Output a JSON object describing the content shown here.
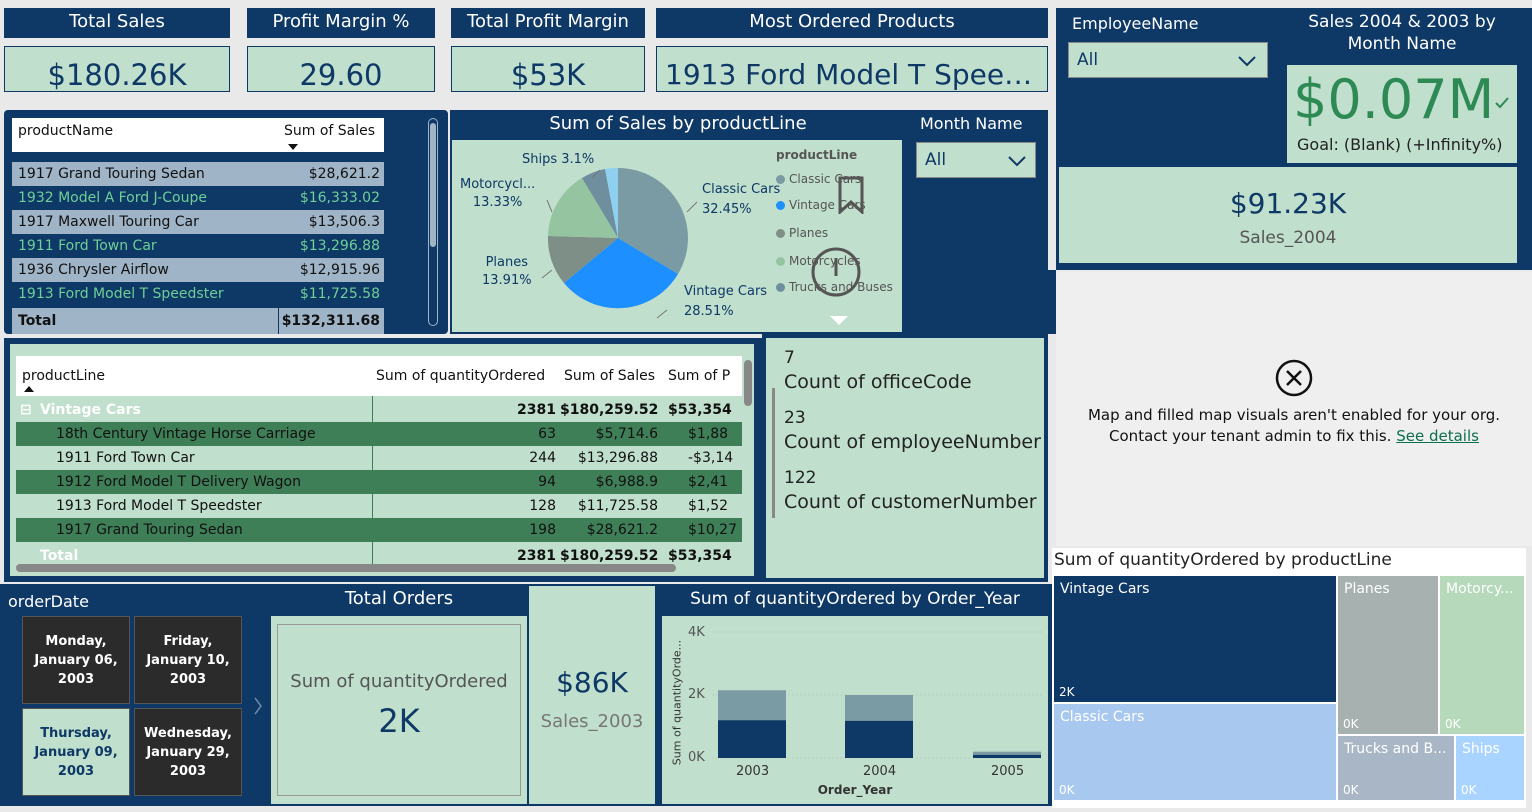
{
  "kpis": {
    "total_sales": {
      "title": "Total Sales",
      "value": "$180.26K"
    },
    "profit_margin_pct": {
      "title": "Profit Margin %",
      "value": "29.60"
    },
    "total_profit_margin": {
      "title": "Total Profit Margin",
      "value": "$53K"
    },
    "most_ordered": {
      "title": "Most Ordered Products",
      "value": "1913 Ford Model T Speed..."
    }
  },
  "employee_slicer": {
    "label": "EmployeeName",
    "value": "All"
  },
  "gauge_card": {
    "title": "Sales 2004 & 2003 by Month Name",
    "value": "$0.07M",
    "goal": "Goal: (Blank) (+Infinity%)"
  },
  "sales_2004_card": {
    "value": "$91.23K",
    "label": "Sales_2004"
  },
  "map_error": {
    "line1": "Map and filled map visuals aren't enabled for your org.",
    "line2": "Contact your tenant admin to fix this.",
    "link": "See details"
  },
  "product_table": {
    "headers": [
      "productName",
      "Sum of Sales"
    ],
    "rows": [
      [
        "1917 Grand Touring Sedan",
        "$28,621.2"
      ],
      [
        "1932 Model A Ford J-Coupe",
        "$16,333.02"
      ],
      [
        "1917 Maxwell Touring Car",
        "$13,506.3"
      ],
      [
        "1911 Ford Town Car",
        "$13,296.88"
      ],
      [
        "1936 Chrysler Airflow",
        "$12,915.96"
      ],
      [
        "1913 Ford Model T Speedster",
        "$11,725.58"
      ]
    ],
    "total_label": "Total",
    "total_value": "$132,311.68"
  },
  "pie": {
    "title": "Sum of Sales by productLine",
    "legend_title": "productLine",
    "legend": [
      {
        "name": "Classic Cars",
        "color": "#7a9aa4"
      },
      {
        "name": "Vintage Cars",
        "color": "#1e8fff"
      },
      {
        "name": "Planes",
        "color": "#7d8f87"
      },
      {
        "name": "Motorcycles",
        "color": "#95c5a0"
      },
      {
        "name": "Trucks and Buses",
        "color": "#6f8f9f"
      }
    ],
    "labels": [
      {
        "name": "Ships 3.1%",
        "pct": ""
      },
      {
        "name": "Motorcycl...",
        "pct": "13.33%"
      },
      {
        "name": "Classic Cars",
        "pct": "32.45%"
      },
      {
        "name": "Planes",
        "pct": "13.91%"
      },
      {
        "name": "Vintage Cars",
        "pct": "28.51%"
      }
    ]
  },
  "chart_data": [
    {
      "type": "pie",
      "title": "Sum of Sales by productLine",
      "categories": [
        "Classic Cars",
        "Vintage Cars",
        "Planes",
        "Motorcycles",
        "Trucks and Buses",
        "Ships"
      ],
      "values": [
        32.45,
        28.51,
        13.91,
        13.33,
        8.7,
        3.1
      ]
    },
    {
      "type": "bar",
      "title": "Sum of quantityOrdered by Order_Year",
      "xlabel": "Order_Year",
      "ylabel": "Sum of quantityOrde...",
      "categories": [
        "2003",
        "2004",
        "2005"
      ],
      "series": [
        {
          "values": [
            1200,
            1180,
            100
          ],
          "color": "#0e3866"
        },
        {
          "values": [
            2150,
            2000,
            200
          ],
          "color": "#7a9aa4"
        }
      ],
      "ylim": [
        0,
        4000
      ],
      "yticks": [
        "0K",
        "2K",
        "4K"
      ]
    },
    {
      "type": "treemap",
      "title": "Sum of quantityOrdered by productLine",
      "categories": [
        "Vintage Cars",
        "Classic Cars",
        "Planes",
        "Motorcy...",
        "Trucks and B...",
        "Ships"
      ],
      "labels": [
        "2K",
        "0K",
        "0K",
        "0K",
        "0K",
        "0K"
      ]
    }
  ],
  "month_slicer": {
    "label": "Month Name",
    "value": "All"
  },
  "matrix": {
    "headers": [
      "productLine",
      "Sum of quantityOrdered",
      "Sum of Sales",
      "Sum of P"
    ],
    "group": {
      "label": "Vintage Cars",
      "qty": "2381",
      "sales": "$180,259.52",
      "profit": "$53,354"
    },
    "rows": [
      {
        "name": "18th Century Vintage Horse Carriage",
        "qty": "63",
        "sales": "$5,714.6",
        "profit": "$1,88"
      },
      {
        "name": "1911 Ford Town Car",
        "qty": "244",
        "sales": "$13,296.88",
        "profit": "-$3,14"
      },
      {
        "name": "1912 Ford Model T Delivery Wagon",
        "qty": "94",
        "sales": "$6,988.9",
        "profit": "$2,41"
      },
      {
        "name": "1913 Ford Model T Speedster",
        "qty": "128",
        "sales": "$11,725.58",
        "profit": "$1,52"
      },
      {
        "name": "1917 Grand Touring Sedan",
        "qty": "198",
        "sales": "$28,621.2",
        "profit": "$10,27"
      }
    ],
    "total": {
      "label": "Total",
      "qty": "2381",
      "sales": "$180,259.52",
      "profit": "$53,354"
    }
  },
  "count_card": {
    "items": [
      {
        "num": "7",
        "label": "Count of officeCode"
      },
      {
        "num": "23",
        "label": "Count of employeeNumber"
      },
      {
        "num": "122",
        "label": "Count of customerNumber"
      }
    ]
  },
  "order_date": {
    "label": "orderDate",
    "buttons": [
      "Monday, January 06, 2003",
      "Friday, January 10, 2003",
      "Thursday, January 09, 2003",
      "Wednesday, January 29, 2003"
    ]
  },
  "total_orders": {
    "title": "Total Orders",
    "label": "Sum of quantityOrdered",
    "value": "2K"
  },
  "sales_2003_card": {
    "value": "$86K",
    "label": "Sales_2003"
  },
  "bar_chart": {
    "title": "Sum of quantityOrdered by Order_Year",
    "xlabel": "Order_Year",
    "ylabel": "Sum of quantityOrde...",
    "yticks": [
      "4K",
      "2K",
      "0K"
    ],
    "xticks": [
      "2003",
      "2004",
      "2005"
    ]
  },
  "treemap": {
    "title": "Sum of quantityOrdered by productLine",
    "cells": [
      {
        "name": "Vintage Cars",
        "value": "2K"
      },
      {
        "name": "Classic Cars",
        "value": "0K"
      },
      {
        "name": "Planes",
        "value": "0K"
      },
      {
        "name": "Motorcy...",
        "value": "0K"
      },
      {
        "name": "Trucks and B...",
        "value": "0K"
      },
      {
        "name": "Ships",
        "value": "0K"
      }
    ]
  }
}
